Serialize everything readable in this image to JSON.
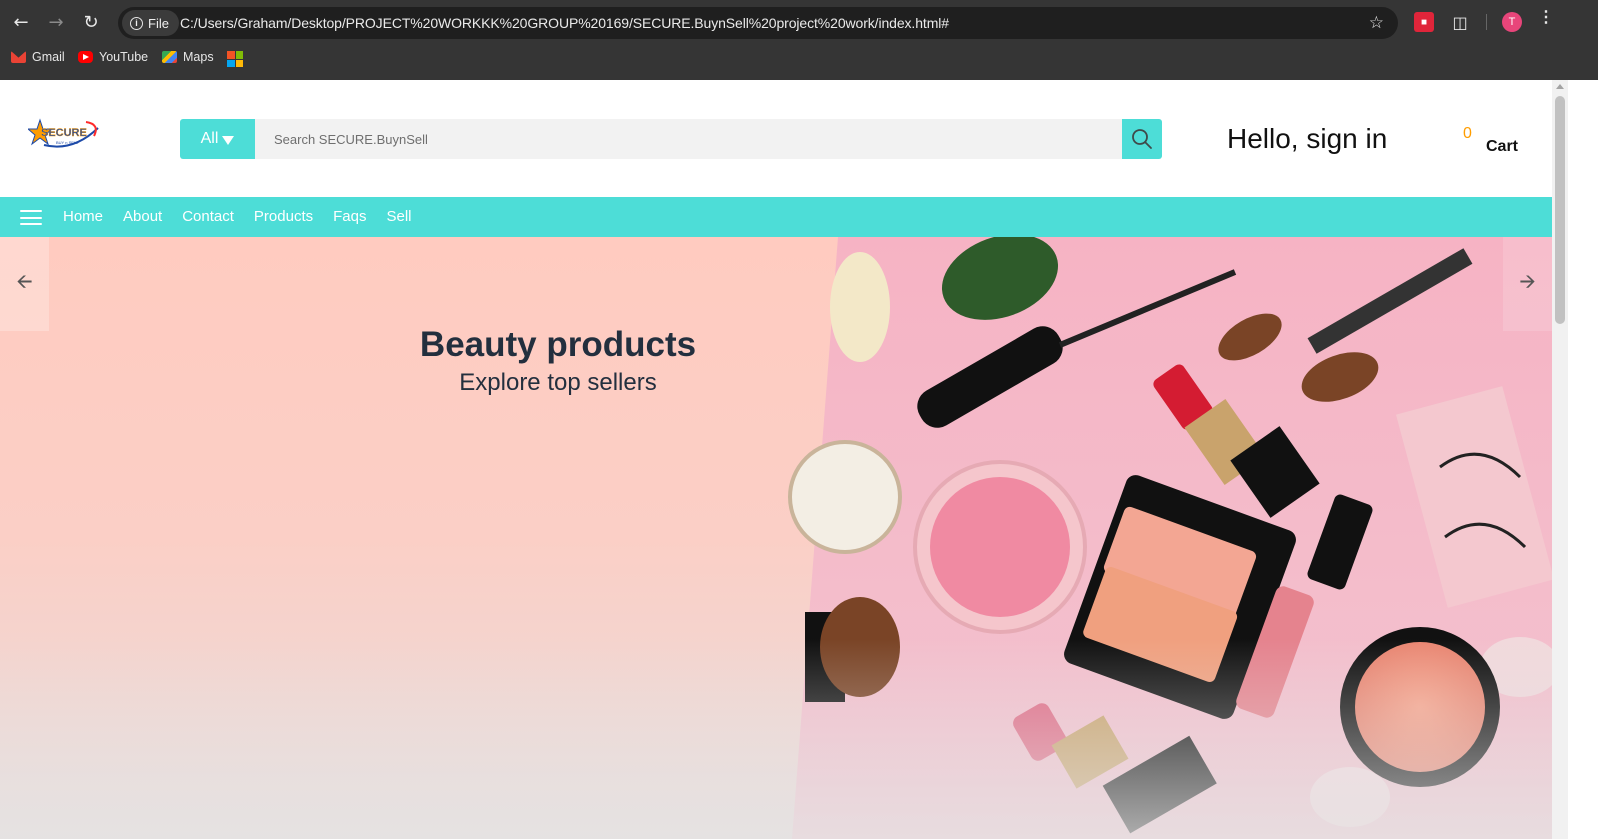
{
  "browser": {
    "file_chip": "File",
    "url": "C:/Users/Graham/Desktop/PROJECT%20WORKKK%20GROUP%20169/SECURE.BuynSell%20project%20work/index.html#",
    "profile_initial": "T",
    "bookmarks": [
      {
        "label": "Gmail",
        "icon": "gmail-icon"
      },
      {
        "label": "YouTube",
        "icon": "youtube-icon"
      },
      {
        "label": "Maps",
        "icon": "maps-icon"
      }
    ]
  },
  "header": {
    "logo_text": "SECURE",
    "logo_tagline": "BUY n SELL",
    "search": {
      "category": "All",
      "placeholder": "Search SECURE.BuynSell"
    },
    "greeting": "Hello, sign in",
    "cart": {
      "count": "0",
      "label": "Cart"
    }
  },
  "nav": {
    "links": [
      "Home",
      "About",
      "Contact",
      "Products",
      "Faqs",
      "Sell"
    ]
  },
  "hero": {
    "title": "Beauty products",
    "subtitle": "Explore top sellers"
  },
  "colors": {
    "accent": "#4dddd7",
    "hero_bg": "#fbcdc2",
    "cart_count": "#ff9d00",
    "heading": "#232f3e"
  }
}
